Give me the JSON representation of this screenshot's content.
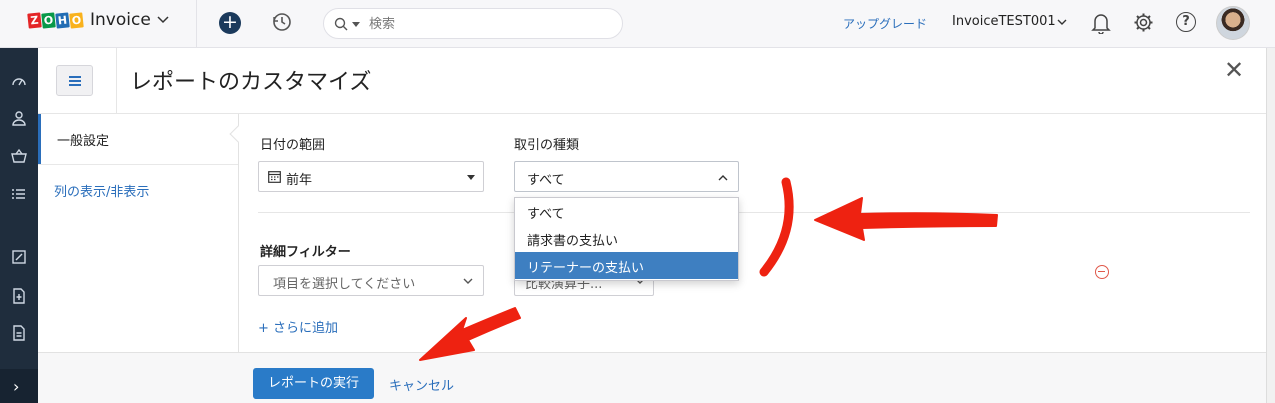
{
  "topbar": {
    "logo_letters": [
      "Z",
      "O",
      "H",
      "O"
    ],
    "logo_colors": [
      "#e42527",
      "#089949",
      "#226db4",
      "#f9b21d"
    ],
    "app_name": "Invoice",
    "search_placeholder": "検索",
    "upgrade_label": "アップグレード",
    "org_name": "InvoiceTEST001",
    "help_label": "?"
  },
  "panel": {
    "title": "レポートのカスタマイズ",
    "close_label": "✕"
  },
  "tabs": [
    {
      "label": "一般設定",
      "active": true
    },
    {
      "label": "列の表示/非表示",
      "active": false
    }
  ],
  "form": {
    "date_range_label": "日付の範囲",
    "date_range_value": "前年",
    "txn_type_label": "取引の種類",
    "txn_type_value": "すべて",
    "txn_type_options": [
      "すべて",
      "請求書の支払い",
      "リテーナーの支払い"
    ],
    "txn_type_highlighted": "リテーナーの支払い",
    "advanced_filter_label": "詳細フィルター",
    "filter_item_placeholder": "項目を選択してください",
    "filter_operator_placeholder": "比較演算子...",
    "add_more_label": "+ さらに追加"
  },
  "footer": {
    "run_label": "レポートの実行",
    "cancel_label": "キャンセル"
  },
  "colors": {
    "accent": "#2a6ebb",
    "nav_bg": "#1f2d3d",
    "annotation": "#ee2211"
  }
}
